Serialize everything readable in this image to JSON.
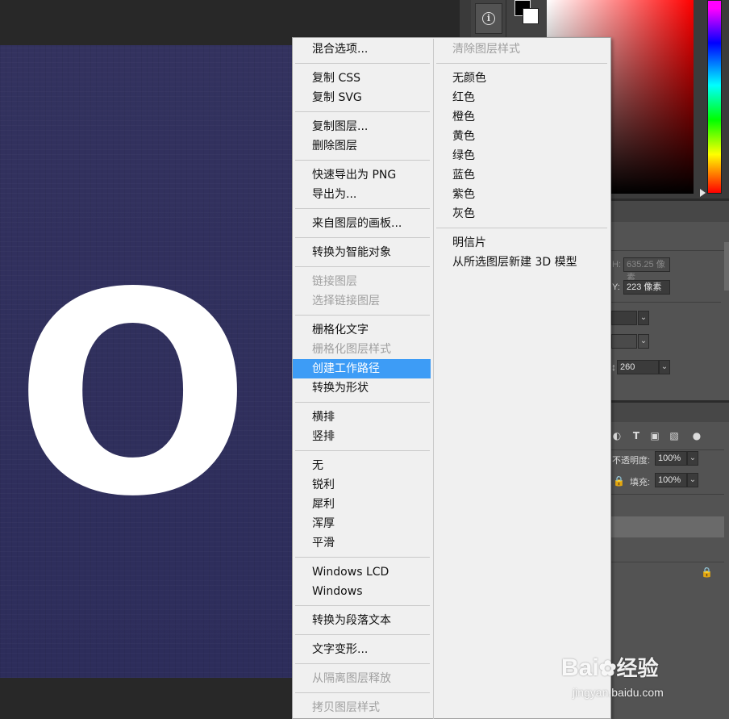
{
  "canvas": {
    "letter": "O",
    "doc_color": "#2f2f5e"
  },
  "colors": {
    "foreground": "#000000",
    "background": "#ffffff",
    "menu_highlight": "#3d9cf6"
  },
  "properties": {
    "h_label": "H:",
    "h_value": "635.25 像素",
    "y_label": "Y:",
    "y_value": "223 像素",
    "size_value": "260"
  },
  "layers": {
    "opacity_label": "不透明度:",
    "opacity_value": "100%",
    "fill_label": "填充:",
    "fill_value": "100%"
  },
  "menu_left": [
    {
      "label": "混合选项...",
      "disabled": false,
      "sep_after": true
    },
    {
      "label": "复制 CSS",
      "disabled": false,
      "sep_after": false
    },
    {
      "label": "复制 SVG",
      "disabled": false,
      "sep_after": true
    },
    {
      "label": "复制图层...",
      "disabled": false,
      "sep_after": false
    },
    {
      "label": "删除图层",
      "disabled": false,
      "sep_after": true
    },
    {
      "label": "快速导出为 PNG",
      "disabled": false,
      "sep_after": false
    },
    {
      "label": "导出为...",
      "disabled": false,
      "sep_after": true
    },
    {
      "label": "来自图层的画板...",
      "disabled": false,
      "sep_after": true
    },
    {
      "label": "转换为智能对象",
      "disabled": false,
      "sep_after": true
    },
    {
      "label": "链接图层",
      "disabled": true,
      "sep_after": false
    },
    {
      "label": "选择链接图层",
      "disabled": true,
      "sep_after": true
    },
    {
      "label": "栅格化文字",
      "disabled": false,
      "sep_after": false
    },
    {
      "label": "栅格化图层样式",
      "disabled": true,
      "sep_after": false
    },
    {
      "label": "创建工作路径",
      "disabled": false,
      "highlighted": true,
      "sep_after": false
    },
    {
      "label": "转换为形状",
      "disabled": false,
      "sep_after": true
    },
    {
      "label": "横排",
      "disabled": false,
      "sep_after": false
    },
    {
      "label": "竖排",
      "disabled": false,
      "sep_after": true
    },
    {
      "label": "无",
      "disabled": false,
      "sep_after": false
    },
    {
      "label": "锐利",
      "disabled": false,
      "sep_after": false
    },
    {
      "label": "犀利",
      "disabled": false,
      "sep_after": false
    },
    {
      "label": "浑厚",
      "disabled": false,
      "sep_after": false
    },
    {
      "label": "平滑",
      "disabled": false,
      "sep_after": true
    },
    {
      "label": "Windows LCD",
      "disabled": false,
      "sep_after": false
    },
    {
      "label": "Windows",
      "disabled": false,
      "sep_after": true
    },
    {
      "label": "转换为段落文本",
      "disabled": false,
      "sep_after": true
    },
    {
      "label": "文字变形...",
      "disabled": false,
      "sep_after": true
    },
    {
      "label": "从隔离图层释放",
      "disabled": true,
      "sep_after": true
    },
    {
      "label": "拷贝图层样式",
      "disabled": true,
      "sep_after": false
    }
  ],
  "menu_right": [
    {
      "label": "清除图层样式",
      "disabled": true,
      "sep_after": true
    },
    {
      "label": "无颜色",
      "disabled": false,
      "sep_after": false
    },
    {
      "label": "红色",
      "disabled": false,
      "sep_after": false
    },
    {
      "label": "橙色",
      "disabled": false,
      "sep_after": false
    },
    {
      "label": "黄色",
      "disabled": false,
      "sep_after": false
    },
    {
      "label": "绿色",
      "disabled": false,
      "sep_after": false
    },
    {
      "label": "蓝色",
      "disabled": false,
      "sep_after": false
    },
    {
      "label": "紫色",
      "disabled": false,
      "sep_after": false
    },
    {
      "label": "灰色",
      "disabled": false,
      "sep_after": true
    },
    {
      "label": "明信片",
      "disabled": false,
      "sep_after": false
    },
    {
      "label": "从所选图层新建 3D 模型",
      "disabled": false,
      "sep_after": false
    }
  ],
  "watermark": {
    "brand": "Bai",
    "brand_suffix": "经验",
    "url": "jingyan.baidu.com"
  }
}
